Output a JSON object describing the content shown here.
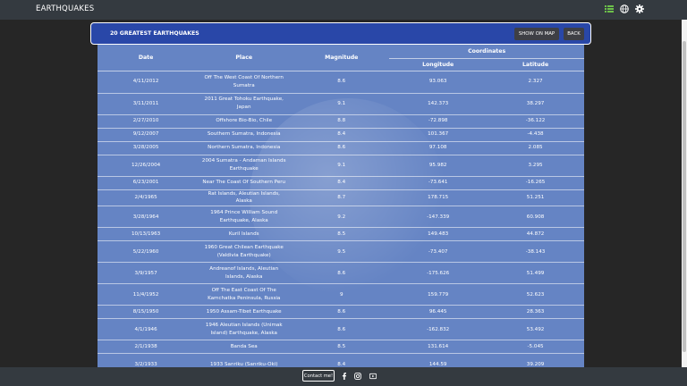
{
  "navbar": {
    "brand": "EARTHQUAKES",
    "icons": [
      "list-icon",
      "globe-icon",
      "gear-icon"
    ]
  },
  "header": {
    "title": "20 GREATEST EARTHQUAKES",
    "map_button": "SHOW ON MAP",
    "back_button": "BACK"
  },
  "table": {
    "headers": {
      "date": "Date",
      "place": "Place",
      "magnitude": "Magnitude",
      "coordinates": "Coordinates",
      "longitude": "Longitude",
      "latitude": "Latitude"
    },
    "rows": [
      {
        "date": "4/11/2012",
        "place": "Off The West Coast Of Northern Sumatra",
        "magnitude": "8.6",
        "longitude": "93.063",
        "latitude": "2.327"
      },
      {
        "date": "3/11/2011",
        "place": "2011 Great Tohoku Earthquake, Japan",
        "magnitude": "9.1",
        "longitude": "142.373",
        "latitude": "38.297"
      },
      {
        "date": "2/27/2010",
        "place": "Offshore Bio-Bio, Chile",
        "magnitude": "8.8",
        "longitude": "-72.898",
        "latitude": "-36.122"
      },
      {
        "date": "9/12/2007",
        "place": "Southern Sumatra, Indonesia",
        "magnitude": "8.4",
        "longitude": "101.367",
        "latitude": "-4.438"
      },
      {
        "date": "3/28/2005",
        "place": "Northern Sumatra, Indonesia",
        "magnitude": "8.6",
        "longitude": "97.108",
        "latitude": "2.085"
      },
      {
        "date": "12/26/2004",
        "place": "2004 Sumatra - Andaman Islands Earthquake",
        "magnitude": "9.1",
        "longitude": "95.982",
        "latitude": "3.295"
      },
      {
        "date": "6/23/2001",
        "place": "Near The Coast Of Southern Peru",
        "magnitude": "8.4",
        "longitude": "-73.641",
        "latitude": "-16.265"
      },
      {
        "date": "2/4/1965",
        "place": "Rat Islands, Aleutian Islands, Alaska",
        "magnitude": "8.7",
        "longitude": "178.715",
        "latitude": "51.251"
      },
      {
        "date": "3/28/1964",
        "place": "1964 Prince William Sound Earthquake, Alaska",
        "magnitude": "9.2",
        "longitude": "-147.339",
        "latitude": "60.908"
      },
      {
        "date": "10/13/1963",
        "place": "Kuril Islands",
        "magnitude": "8.5",
        "longitude": "149.483",
        "latitude": "44.872"
      },
      {
        "date": "5/22/1960",
        "place": "1960 Great Chilean Earthquake (Valdivia Earthquake)",
        "magnitude": "9.5",
        "longitude": "-73.407",
        "latitude": "-38.143"
      },
      {
        "date": "3/9/1957",
        "place": "Andreanof Islands, Aleutian Islands, Alaska",
        "magnitude": "8.6",
        "longitude": "-175.626",
        "latitude": "51.499"
      },
      {
        "date": "11/4/1952",
        "place": "Off The East Coast Of The Kamchatka Peninsula, Russia",
        "magnitude": "9",
        "longitude": "159.779",
        "latitude": "52.623"
      },
      {
        "date": "8/15/1950",
        "place": "1950 Assam-Tibet Earthquake",
        "magnitude": "8.6",
        "longitude": "96.445",
        "latitude": "28.363"
      },
      {
        "date": "4/1/1946",
        "place": "1946 Aleutian Islands (Unimak Island) Earthquake, Alaska",
        "magnitude": "8.6",
        "longitude": "-162.832",
        "latitude": "53.492"
      },
      {
        "date": "2/1/1938",
        "place": "Banda Sea",
        "magnitude": "8.5",
        "longitude": "131.614",
        "latitude": "-5.045"
      },
      {
        "date": "3/2/1933",
        "place": "1933 Sanriku (Sanriku-Oki)",
        "magnitude": "8.4",
        "longitude": "144.59",
        "latitude": "39.209"
      }
    ]
  },
  "footer": {
    "contact_label": "Contact me!",
    "icons": [
      "facebook-icon",
      "instagram-icon",
      "youtube-icon"
    ]
  }
}
